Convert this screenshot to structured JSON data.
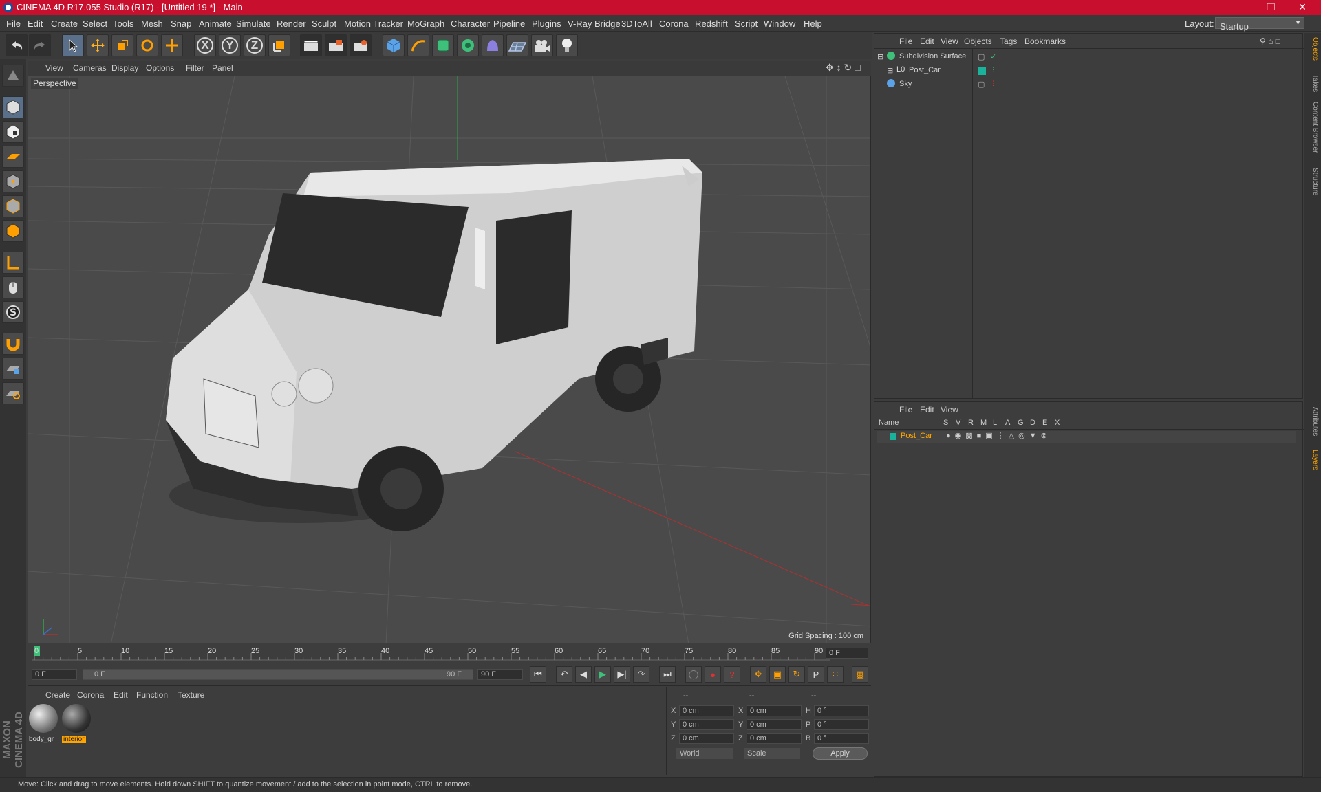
{
  "title": "CINEMA 4D R17.055 Studio (R17) - [Untitled 19 *] - Main",
  "menu": [
    "File",
    "Edit",
    "Create",
    "Select",
    "Tools",
    "Mesh",
    "Snap",
    "Animate",
    "Simulate",
    "Render",
    "Sculpt",
    "Motion Tracker",
    "MoGraph",
    "Character",
    "Pipeline",
    "Plugins",
    "V-Ray Bridge",
    "3DToAll",
    "Corona",
    "Redshift",
    "Script",
    "Window",
    "Help"
  ],
  "layout": {
    "label": "Layout:",
    "value": "Startup"
  },
  "viewport": {
    "menu": [
      "View",
      "Cameras",
      "Display",
      "Options",
      "Filter",
      "Panel"
    ],
    "label": "Perspective",
    "grid_spacing": "Grid Spacing : 100 cm"
  },
  "timeline": {
    "ticks": [
      "0",
      "5",
      "10",
      "15",
      "20",
      "25",
      "30",
      "35",
      "40",
      "45",
      "50",
      "55",
      "60",
      "65",
      "70",
      "75",
      "80",
      "85",
      "90"
    ],
    "current_frame": "0 F",
    "start": "0 F",
    "range_start": "0 F",
    "range_end": "90 F",
    "end": "90 F"
  },
  "materials": {
    "menu": [
      "Create",
      "Corona",
      "Edit",
      "Function",
      "Texture"
    ],
    "items": [
      {
        "name": "body_gr"
      },
      {
        "name": "interior"
      }
    ]
  },
  "coords": {
    "header": [
      "--",
      "--",
      "--"
    ],
    "rows": [
      {
        "a": "X",
        "v1": "0 cm",
        "b": "X",
        "v2": "0 cm",
        "c": "H",
        "v3": "0 °"
      },
      {
        "a": "Y",
        "v1": "0 cm",
        "b": "Y",
        "v2": "0 cm",
        "c": "P",
        "v3": "0 °"
      },
      {
        "a": "Z",
        "v1": "0 cm",
        "b": "Z",
        "v2": "0 cm",
        "c": "B",
        "v3": "0 °"
      }
    ],
    "world": "World",
    "scale": "Scale",
    "apply": "Apply"
  },
  "objects": {
    "menu": [
      "File",
      "Edit",
      "View",
      "Objects",
      "Tags",
      "Bookmarks"
    ],
    "items": [
      {
        "name": "Subdivision Surface"
      },
      {
        "name": "Post_Car"
      },
      {
        "name": "Sky"
      }
    ]
  },
  "layers": {
    "menu": [
      "File",
      "Edit",
      "View"
    ],
    "columns": [
      "Name",
      "S",
      "V",
      "R",
      "M",
      "L",
      "A",
      "G",
      "D",
      "E",
      "X"
    ],
    "rows": [
      {
        "name": "Post_Car"
      }
    ]
  },
  "right_tabs": [
    "Objects",
    "Takes",
    "Content Browser",
    "Structure",
    "Attributes",
    "Layers"
  ],
  "brand": "MAXON CINEMA 4D",
  "status": "Move: Click and drag to move elements. Hold down SHIFT to quantize movement / add to the selection in point mode, CTRL to remove.",
  "colors": {
    "title_bar": "#c8102e",
    "accent": "#ffa500",
    "layer": "#19b39b"
  }
}
